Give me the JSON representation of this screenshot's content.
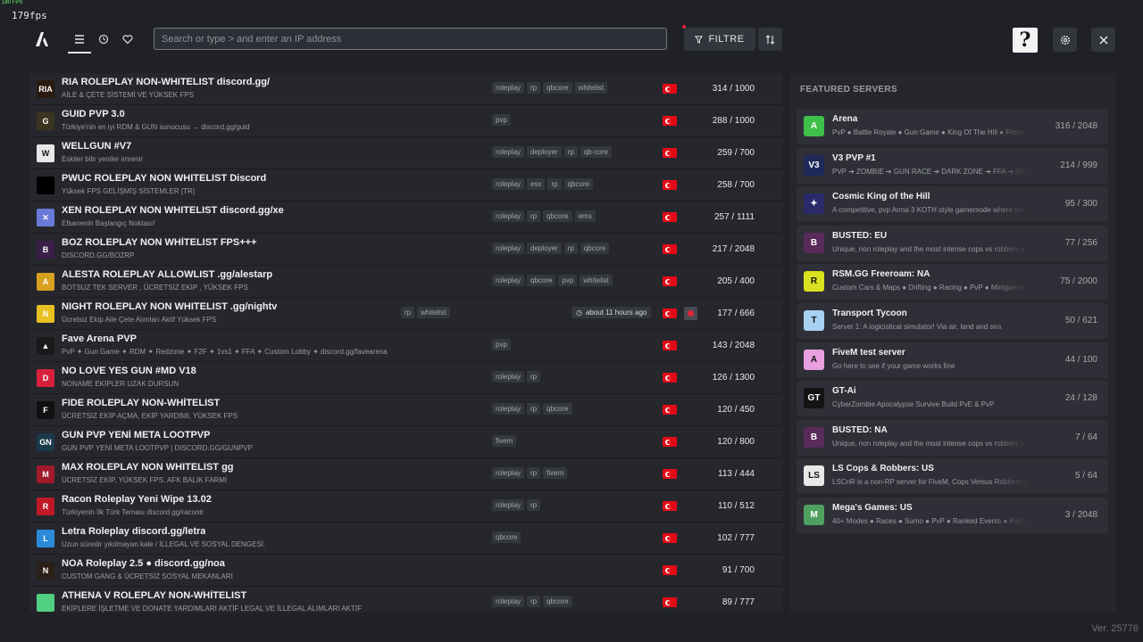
{
  "overlay": {
    "fps_tiny": "180 FPS",
    "fps": "179fps"
  },
  "toolbar": {
    "search_placeholder": "Search or type > and enter an IP address",
    "filter_label": "FILTRE",
    "help_glyph": "?"
  },
  "servers": [
    {
      "name": "RIA ROLEPLAY NON-WHITELIST discord.gg/",
      "desc": "AİLE & ÇETE SİSTEMİ VE YÜKSEK FPS",
      "tags": [
        "roleplay",
        "rp",
        "qbcore",
        "whitelist"
      ],
      "count": "314 / 1000",
      "icon_bg": "#2a1a10",
      "icon_text": "RIA"
    },
    {
      "name": "GUID PVP 3.0",
      "desc": "Türkiye'nin en iyi RDM & GUN sunucusu → discord.gg/guid",
      "tags": [
        "pvp"
      ],
      "count": "288 / 1000",
      "icon_bg": "#3a3420",
      "icon_text": "G"
    },
    {
      "name": "WELLGUN #V7",
      "desc": "Eskiler bilir yeniler imrenir",
      "tags": [
        "roleplay",
        "deployer",
        "rp",
        "qb-core"
      ],
      "count": "259 / 700",
      "icon_bg": "#e8e8e8",
      "icon_text": "W"
    },
    {
      "name": "PWUC ROLEPLAY NON WHITELIST Discord",
      "desc": "Yüksek FPS GELİŞMİŞ SİSTEMLER [TR]",
      "tags": [
        "roleplay",
        "esx",
        "rp",
        "qbcore"
      ],
      "count": "258 / 700",
      "icon_bg": "#000000",
      "icon_text": ""
    },
    {
      "name": "XEN ROLEPLAY NON WHITELIST discord.gg/xe",
      "desc": "Efsanenin Başlangıç Noktası!",
      "tags": [
        "roleplay",
        "rp",
        "qbcore",
        "ems"
      ],
      "count": "257 / 1111",
      "icon_bg": "#6a7ad8",
      "icon_text": "✕"
    },
    {
      "name": "BOZ ROLEPLAY NON WHİTELIST FPS+++",
      "desc": "DISCORD.GG/BOZRP",
      "tags": [
        "roleplay",
        "deployer",
        "rp",
        "qbcore"
      ],
      "count": "217 / 2048",
      "icon_bg": "#3a1f4a",
      "icon_text": "B"
    },
    {
      "name": "ALESTA ROLEPLAY ALLOWLIST .gg/alestarp",
      "desc": "BOTSUZ TEK SERVER , ÜCRETSİZ EKİP , YÜKSEK FPS",
      "tags": [
        "roleplay",
        "qbcore",
        "pvp",
        "whitelist"
      ],
      "count": "205 / 400",
      "icon_bg": "#d8a020",
      "icon_text": "A"
    },
    {
      "name": "NIGHT ROLEPLAY NON WHITELIST .gg/nightv",
      "desc": "Ücretsiz Ekip Aile Çete Alımları Aktif Yüksek FPS",
      "tags": [
        "rp",
        "whitelist"
      ],
      "count": "177 / 666",
      "icon_bg": "#e8c020",
      "icon_text": "N",
      "ago": "about 11 hours ago"
    },
    {
      "name": "Fave Arena PVP",
      "desc": "PvP ✦ Gun Game ✦ RDM ✦ Redzone ✦ F2F ✦ 1vs1 ✦ FFA ✦ Custom Lobby ✦ discord.gg/favearena",
      "tags": [
        "pvp"
      ],
      "count": "143 / 2048",
      "icon_bg": "#1a1a1a",
      "icon_text": "▲"
    },
    {
      "name": "NO LOVE YES GUN #MD V18",
      "desc": "NONAME EKİPLER UZAK DURSUN",
      "tags": [
        "roleplay",
        "rp"
      ],
      "count": "126 / 1300",
      "icon_bg": "#d8203a",
      "icon_text": "D"
    },
    {
      "name": "FIDE ROLEPLAY NON-WHİTELIST",
      "desc": "ÜCRETSİZ EKİP AÇMA, EKİP YARDIMI, YÜKSEK FPS",
      "tags": [
        "roleplay",
        "rp",
        "qbcore"
      ],
      "count": "120 / 450",
      "icon_bg": "#101010",
      "icon_text": "F"
    },
    {
      "name": "GUN PVP YENİ META LOOTPVP",
      "desc": "GUN PVP YENİ META LOOTPVP | DISCORD.GG/GUNPVP",
      "tags": [
        "fivem"
      ],
      "count": "120 / 800",
      "icon_bg": "#1a3a4a",
      "icon_text": "GN"
    },
    {
      "name": "MAX ROLEPLAY NON WHITELIST gg",
      "desc": "ÜCRETSİZ EKİP, YÜKSEK FPS, AFK BALIK FARMI",
      "tags": [
        "roleplay",
        "rp",
        "fivem"
      ],
      "count": "113 / 444",
      "icon_bg": "#a01a2a",
      "icon_text": "M"
    },
    {
      "name": "Racon Roleplay Yeni Wipe 13.02",
      "desc": "Türkiyenin İlk Türk Teması discord.gg/racontr",
      "tags": [
        "roleplay",
        "rp"
      ],
      "count": "110 / 512",
      "icon_bg": "#c01828",
      "icon_text": "R"
    },
    {
      "name": "Letra Roleplay discord.gg/letra",
      "desc": "Uzun süredir yıkılmayan kale / İLLEGAL VE SOSYAL DENGESİ.",
      "tags": [
        "qbcore"
      ],
      "count": "102 / 777",
      "icon_bg": "#2a8ad8",
      "icon_text": "L"
    },
    {
      "name": "NOA Roleplay 2.5 ● discord.gg/noa",
      "desc": "CUSTOM GANG & ÜCRETSİZ SOSYAL MEKANLARI",
      "tags": [],
      "count": "91 / 700",
      "icon_bg": "#2a2018",
      "icon_text": "N"
    },
    {
      "name": "ATHENA V ROLEPLAY NON-WHİTELIST",
      "desc": "EKİPLERE İŞLETME VE DONATE YARDIMLARI AKTİF LEGAL VE İLLEGAL ALIMLARI AKTİF",
      "tags": [
        "roleplay",
        "rp",
        "qbcore"
      ],
      "count": "89 / 777",
      "icon_bg": "#50d080",
      "icon_text": ""
    }
  ],
  "featured": {
    "title": "FEATURED SERVERS",
    "items": [
      {
        "name": "Arena",
        "desc": "PvP ● Battle Royale ● Gun Game ● King Of The Hill ● Freemode",
        "count": "316 / 2048",
        "icon_bg": "#3fc04a",
        "icon_text": "A"
      },
      {
        "name": "V3 PVP #1",
        "desc": "PVP ➔ ZOMBIE ➔ GUN RACE ➔ DARK ZONE ➔ FFA ➔ AIRDROP",
        "count": "214 / 999",
        "icon_bg": "#1e2a5a",
        "icon_text": "V3"
      },
      {
        "name": "Cosmic King of the Hill",
        "desc": "A competitive, pvp Arma 3 KOTH style gamemode where you",
        "count": "95 / 300",
        "icon_bg": "#2a2a6a",
        "icon_text": "✦"
      },
      {
        "name": "BUSTED: EU",
        "desc": "Unique, non roleplay and the most intense cops vs robbers experience",
        "count": "77 / 256",
        "icon_bg": "#5a2a5a",
        "icon_text": "B"
      },
      {
        "name": "RSM.GG Freeroam: NA",
        "desc": "Custom Cars & Maps ● Drifting ● Racing ● PvP ● Minigames ●",
        "count": "75 / 2000",
        "icon_bg": "#d8e020",
        "icon_text": "R"
      },
      {
        "name": "Transport Tycoon",
        "desc": "Server 1: A logicistical simulator! Via air, land and sea",
        "count": "50 / 621",
        "icon_bg": "#a8d0f0",
        "icon_text": "T"
      },
      {
        "name": "FiveM test server",
        "desc": "Go here to see if your game works fine",
        "count": "44 / 100",
        "icon_bg": "#e8a0e0",
        "icon_text": "A"
      },
      {
        "name": "GT-Ai",
        "desc": "CyberZombie Apocalypse Survive Build PvE & PvP",
        "count": "24 / 128",
        "icon_bg": "#141414",
        "icon_text": "GT"
      },
      {
        "name": "BUSTED: NA",
        "desc": "Unique, non roleplay and the most intense cops vs robbers experience",
        "count": "7 / 64",
        "icon_bg": "#5a2a5a",
        "icon_text": "B"
      },
      {
        "name": "LS Cops & Robbers: US",
        "desc": "LSCnR is a non-RP server for FiveM, Cops Versus Robbers freeroam",
        "count": "5 / 64",
        "icon_bg": "#e8e8e8",
        "icon_text": "LS"
      },
      {
        "name": "Mega's Games: US",
        "desc": "40+ Modes ● Races ● Sumo ● PvP ● Ranked Events ● Parties ●",
        "count": "3 / 2048",
        "icon_bg": "#50a060",
        "icon_text": "M"
      }
    ]
  },
  "version": "Ver. 25776"
}
